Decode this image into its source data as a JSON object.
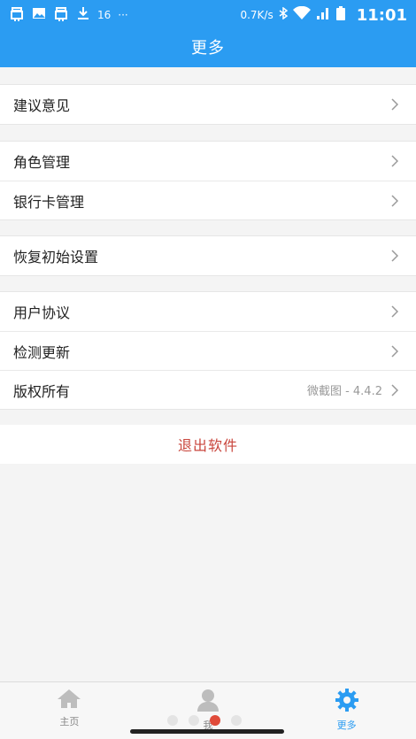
{
  "status_bar": {
    "left_icons": [
      "bug-icon",
      "image-icon",
      "bug-icon",
      "download-icon"
    ],
    "small_text": "16",
    "more": "···",
    "speed": "0.7K/s",
    "time": "11:01"
  },
  "header": {
    "title": "更多"
  },
  "groups": {
    "g1": [
      {
        "label": "建议意见"
      }
    ],
    "g2": [
      {
        "label": "角色管理"
      },
      {
        "label": "银行卡管理"
      }
    ],
    "g3": [
      {
        "label": "恢复初始设置"
      }
    ],
    "g4": [
      {
        "label": "用户协议"
      },
      {
        "label": "检测更新"
      },
      {
        "label": "版权所有",
        "value": "微截图 - 4.4.2"
      }
    ]
  },
  "logout": {
    "label": "退出软件"
  },
  "bottom_nav": {
    "tabs": [
      {
        "label": "主页",
        "icon": "home-icon"
      },
      {
        "label": "我",
        "icon": "user-icon"
      },
      {
        "label": "更多",
        "icon": "gear-icon"
      }
    ],
    "active_index": 2
  },
  "colors": {
    "accent": "#2b9cf2",
    "logout": "#c9463d"
  }
}
